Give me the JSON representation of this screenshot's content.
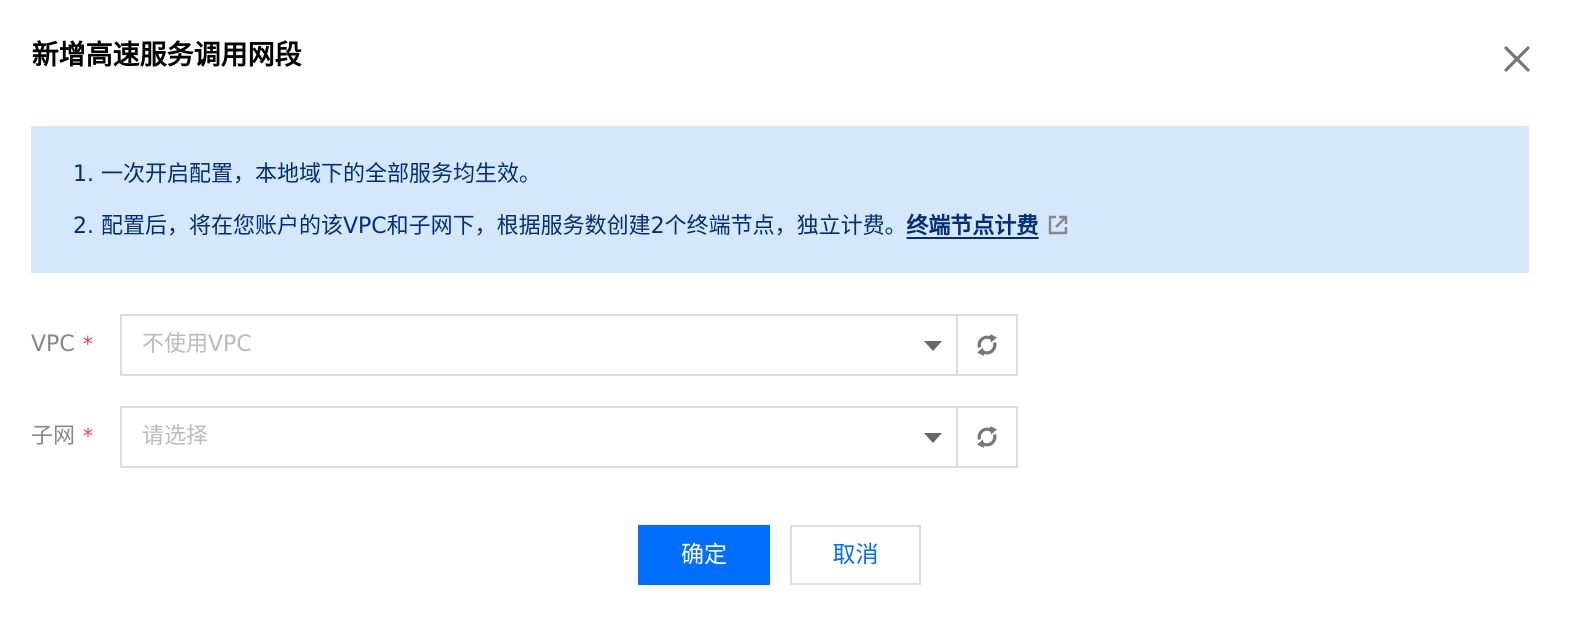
{
  "dialog": {
    "title": "新增高速服务调用网段"
  },
  "notice": {
    "line1": "1. 一次开启配置，本地域下的全部服务均生效。",
    "line2": "2. 配置后，将在您账户的该VPC和子网下，根据服务数创建2个终端节点，独立计费。",
    "link": "终端节点计费"
  },
  "form": {
    "vpc": {
      "label": "VPC",
      "required_mark": "*",
      "placeholder": "不使用VPC"
    },
    "subnet": {
      "label": "子网",
      "required_mark": "*",
      "placeholder": "请选择"
    }
  },
  "actions": {
    "confirm_label": "确定",
    "cancel_label": "取消"
  },
  "colors": {
    "primary": "#006eff",
    "notice_bg": "#d5e7fd",
    "notice_text": "#002e7a",
    "required": "#e54545"
  },
  "icons": {
    "close": "close-icon",
    "external": "external-link-icon",
    "caret": "caret-down-icon",
    "refresh": "refresh-icon"
  }
}
